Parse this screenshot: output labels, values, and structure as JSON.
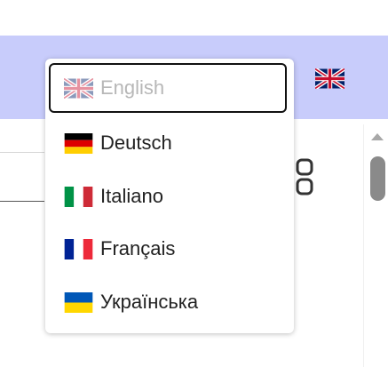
{
  "header": {
    "current_language_flag": "uk-flag-icon",
    "background": "#c8ccfb"
  },
  "language_dropdown": {
    "options": [
      {
        "label": "English",
        "flag": "uk-flag-icon",
        "selected": true
      },
      {
        "label": "Deutsch",
        "flag": "germany-flag-icon",
        "selected": false
      },
      {
        "label": "Italiano",
        "flag": "italy-flag-icon",
        "selected": false
      },
      {
        "label": "Français",
        "flag": "france-flag-icon",
        "selected": false
      },
      {
        "label": "Українська",
        "flag": "ukraine-flag-icon",
        "selected": false
      }
    ]
  },
  "colors": {
    "selected_text": "#b7b7b7",
    "text": "#222222"
  }
}
